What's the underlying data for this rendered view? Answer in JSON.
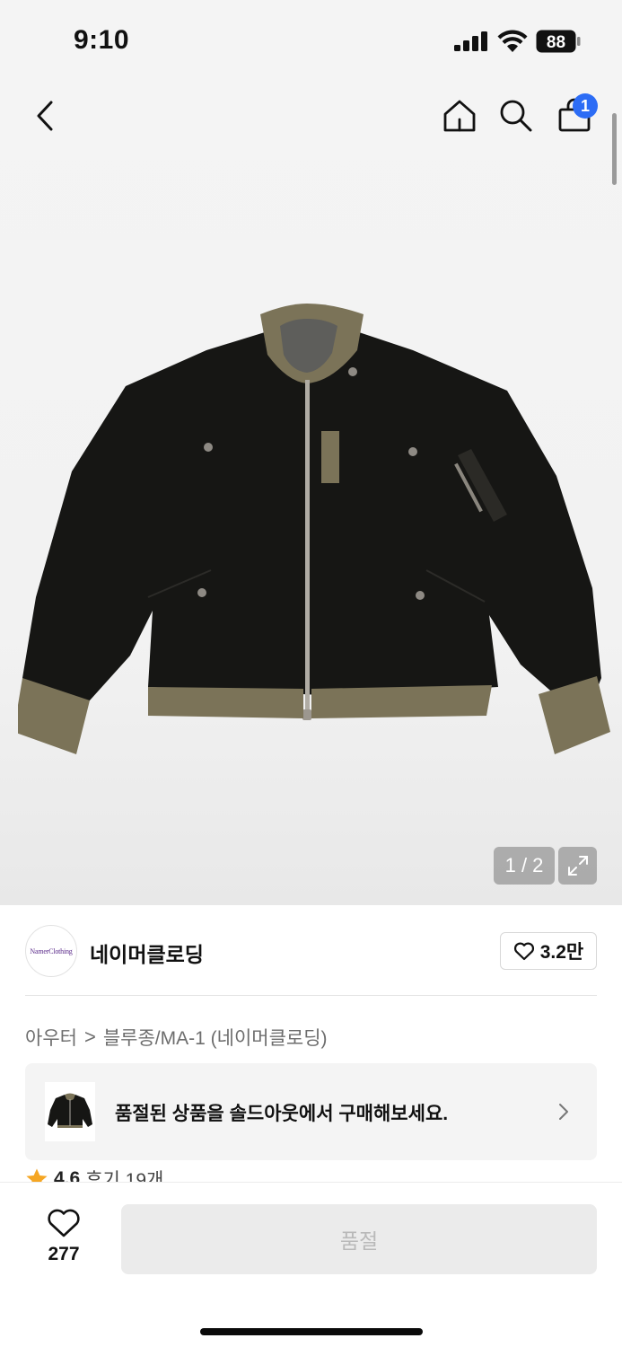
{
  "status_bar": {
    "time": "9:10",
    "battery": "88"
  },
  "nav": {
    "cart_count": "1"
  },
  "gallery": {
    "page_indicator": "1 / 2"
  },
  "brand": {
    "logo_text": "NamerClothing",
    "name": "네이머클로딩",
    "likes": "3.2만"
  },
  "breadcrumb": {
    "category": "아우터",
    "separator": ">",
    "subcategory": "블루종/MA-1 (네이머클로딩)"
  },
  "soldout_banner": {
    "text": "품절된 상품을 솔드아웃에서 구매해보세요."
  },
  "rating": {
    "score": "4.6",
    "reviews": "후기 19개"
  },
  "bottom_bar": {
    "wish_count": "277",
    "buy_label": "품절"
  },
  "colors": {
    "accent": "#2c6cf5",
    "star": "#f5a623",
    "disabled_bg": "#ebebeb"
  }
}
